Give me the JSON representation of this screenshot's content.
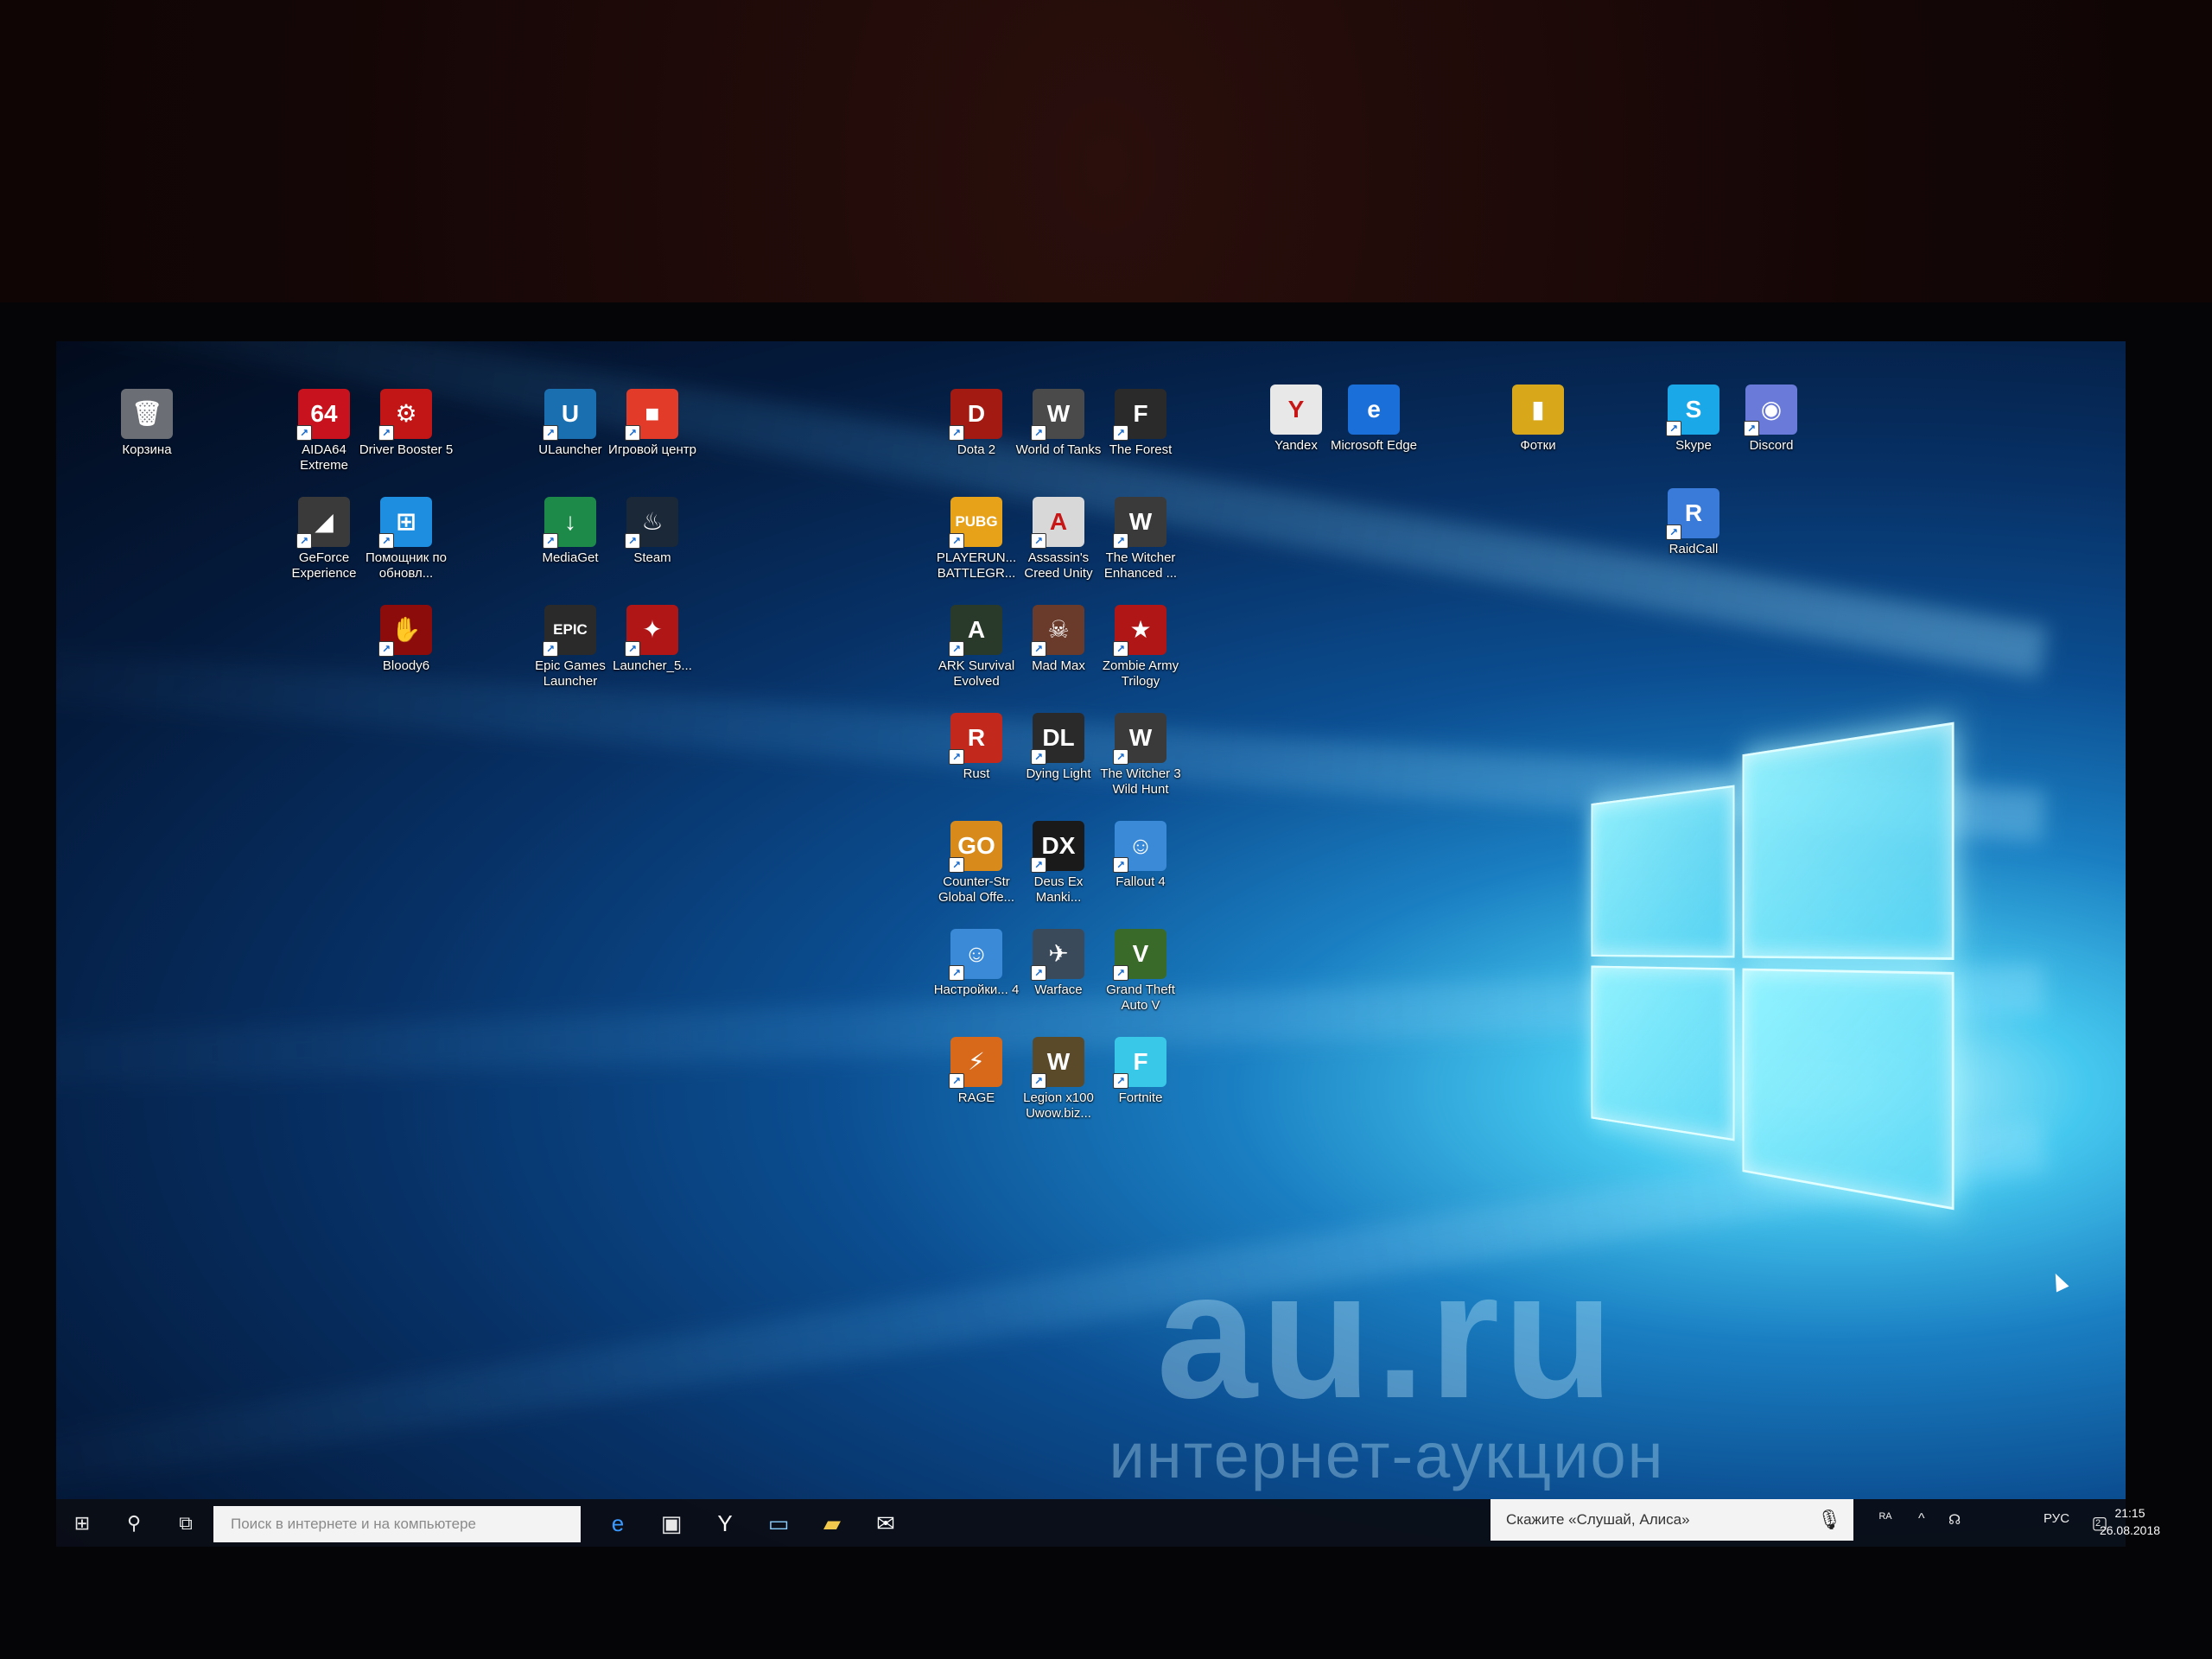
{
  "watermark": {
    "site": "au.ru",
    "tagline": "интернет-аукцион"
  },
  "desktop_icons": [
    {
      "label": "Корзина",
      "glyph": "🗑",
      "color": "#6b6e74",
      "shortcut": false
    },
    {
      "label": "AIDA64 Extreme",
      "glyph": "64",
      "color": "#c8121d",
      "shortcut": true
    },
    {
      "label": "Driver Booster 5",
      "glyph": "⚙",
      "color": "#c21515",
      "shortcut": true
    },
    {
      "label": "GeForce Experience",
      "glyph": "◢",
      "color": "#3a3a3a",
      "shortcut": true
    },
    {
      "label": "Помощник по обновл...",
      "glyph": "⊞",
      "color": "#1e8fe0",
      "shortcut": true
    },
    {
      "label": "Bloody6",
      "glyph": "✋",
      "color": "#8c0c0c",
      "shortcut": true
    },
    {
      "label": "ULauncher",
      "glyph": "U",
      "color": "#1a6fb0",
      "shortcut": true
    },
    {
      "label": "Игровой центр",
      "glyph": "■",
      "color": "#e23b2a",
      "shortcut": true
    },
    {
      "label": "MediaGet",
      "glyph": "↓",
      "color": "#1d8a4a",
      "shortcut": true
    },
    {
      "label": "Steam",
      "glyph": "♨",
      "color": "#1b2838",
      "shortcut": true
    },
    {
      "label": "Epic Games Launcher",
      "glyph": "EPIC",
      "color": "#2a2a2a",
      "shortcut": true
    },
    {
      "label": "Launcher_5...",
      "glyph": "✦",
      "color": "#b01616",
      "shortcut": true
    },
    {
      "label": "Dota 2",
      "glyph": "D",
      "color": "#a31a12",
      "shortcut": true
    },
    {
      "label": "World of Tanks",
      "glyph": "W",
      "color": "#4a4a4a",
      "shortcut": true
    },
    {
      "label": "The Forest",
      "glyph": "F",
      "color": "#2a2a2a",
      "shortcut": true
    },
    {
      "label": "PLAYERUN... BATTLEGR...",
      "glyph": "PUBG",
      "color": "#e8a21a",
      "shortcut": true
    },
    {
      "label": "Assassin's Creed Unity",
      "glyph": "A",
      "color": "#d8d8d8",
      "shortcut": true
    },
    {
      "label": "The Witcher Enhanced ...",
      "glyph": "W",
      "color": "#3a3a3a",
      "shortcut": true
    },
    {
      "label": "ARK Survival Evolved",
      "glyph": "A",
      "color": "#2a3a2a",
      "shortcut": true
    },
    {
      "label": "Mad Max",
      "glyph": "☠",
      "color": "#6a3a2a",
      "shortcut": true
    },
    {
      "label": "Zombie Army Trilogy",
      "glyph": "★",
      "color": "#b01616",
      "shortcut": true
    },
    {
      "label": "Rust",
      "glyph": "R",
      "color": "#c2281c",
      "shortcut": true
    },
    {
      "label": "Dying Light",
      "glyph": "DL",
      "color": "#2a2a2a",
      "shortcut": true
    },
    {
      "label": "The Witcher 3 Wild Hunt",
      "glyph": "W",
      "color": "#3a3a3a",
      "shortcut": true
    },
    {
      "label": "Counter-Str Global Offe...",
      "glyph": "GO",
      "color": "#d88a1a",
      "shortcut": true
    },
    {
      "label": "Deus Ex Manki...",
      "glyph": "DX",
      "color": "#1a1a1a",
      "shortcut": true
    },
    {
      "label": "Fallout 4",
      "glyph": "☺",
      "color": "#3a8ad8",
      "shortcut": true
    },
    {
      "label": "Настройки... 4",
      "glyph": "☺",
      "color": "#3a8ad8",
      "shortcut": true
    },
    {
      "label": "Warface",
      "glyph": "✈",
      "color": "#3a4a5a",
      "shortcut": true
    },
    {
      "label": "Grand Theft Auto V",
      "glyph": "V",
      "color": "#3a6a2a",
      "shortcut": true
    },
    {
      "label": "RAGE",
      "glyph": "⚡",
      "color": "#d8681a",
      "shortcut": true
    },
    {
      "label": "Legion x100 Uwow.biz...",
      "glyph": "W",
      "color": "#5a4a2a",
      "shortcut": true
    },
    {
      "label": "Fortnite",
      "glyph": "F",
      "color": "#3ac8e8",
      "shortcut": true
    },
    {
      "label": "Yandex",
      "glyph": "Y",
      "color": "#e8e8e8",
      "shortcut": false
    },
    {
      "label": "Microsoft Edge",
      "glyph": "e",
      "color": "#1a6fd8",
      "shortcut": false
    },
    {
      "label": "Фотки",
      "glyph": "▮",
      "color": "#d8a81a",
      "shortcut": false
    },
    {
      "label": "Skype",
      "glyph": "S",
      "color": "#1aa8e8",
      "shortcut": true
    },
    {
      "label": "Discord",
      "glyph": "◉",
      "color": "#6a7ad8",
      "shortcut": true
    },
    {
      "label": "RaidCall",
      "glyph": "R",
      "color": "#3a7ad8",
      "shortcut": true
    }
  ],
  "taskbar": {
    "start_icon": "windows-logo-icon",
    "search_icon": "search-icon",
    "taskview_icon": "task-view-icon",
    "search_placeholder": "Поиск в интернете и на компьютере",
    "pinned": [
      {
        "name": "edge-icon",
        "glyph": "e",
        "color": "#3a9aff"
      },
      {
        "name": "store-icon",
        "glyph": "▣",
        "color": "#e8e8e8"
      },
      {
        "name": "yandex-browser-icon",
        "glyph": "Y",
        "color": "#ffffff"
      },
      {
        "name": "mail-icon",
        "glyph": "▭",
        "color": "#8ad0ff"
      },
      {
        "name": "file-explorer-icon",
        "glyph": "▰",
        "color": "#f2c94c"
      },
      {
        "name": "envelope-icon",
        "glyph": "✉",
        "color": "#ffffff"
      }
    ],
    "alice_placeholder": "Скажите «Слушай, Алиса»",
    "tray": {
      "people_icon": "ᴿᴬ",
      "chevron_icon": "^",
      "network_icon": "☊",
      "language": "РУС",
      "time": "21:15",
      "date": "26.08.2018",
      "notifications_count": "2"
    }
  }
}
